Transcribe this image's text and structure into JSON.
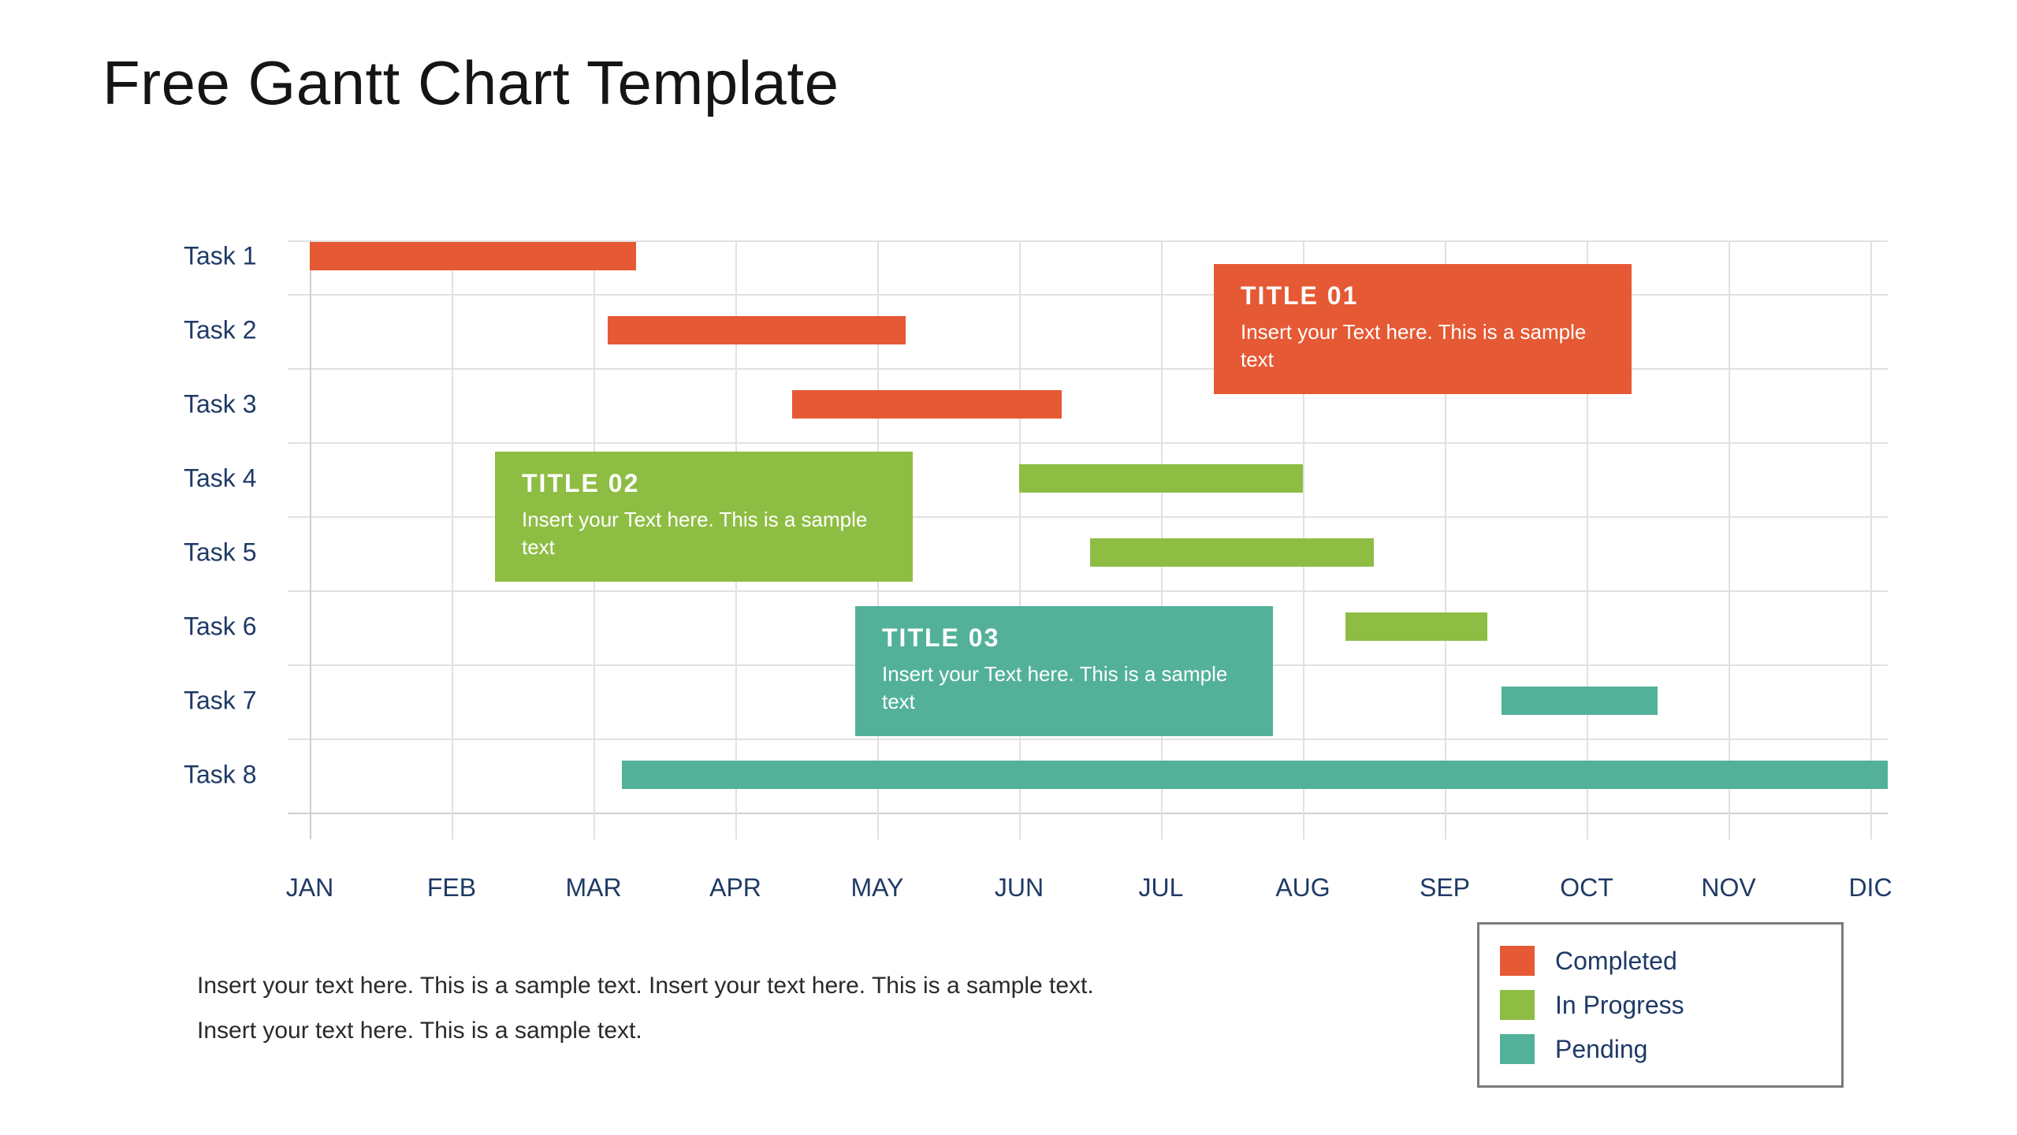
{
  "title": "Free Gantt Chart Template",
  "footer_text": "Insert your text here. This is a sample text. Insert your text here. This is a sample text.\nInsert your text here. This is a sample text.",
  "legend": {
    "completed": "Completed",
    "in_progress": "In Progress",
    "pending": "Pending"
  },
  "colors": {
    "completed": "#e55934",
    "in_progress": "#8ebd44",
    "pending": "#53b19a"
  },
  "callouts": [
    {
      "title": "TITLE 01",
      "body": "Insert your Text here. This is a sample text"
    },
    {
      "title": "TITLE 02",
      "body": "Insert your Text here. This is a sample text"
    },
    {
      "title": "TITLE 03",
      "body": "Insert your Text here. This is a sample text"
    }
  ],
  "chart_data": {
    "type": "bar",
    "orientation": "horizontal-gantt",
    "categories": [
      "JAN",
      "FEB",
      "MAR",
      "APR",
      "MAY",
      "JUN",
      "JUL",
      "AUG",
      "SEP",
      "OCT",
      "NOV",
      "DIC"
    ],
    "tasks": [
      "Task 1",
      "Task 2",
      "Task 3",
      "Task 4",
      "Task 5",
      "Task 6",
      "Task 7",
      "Task 8"
    ],
    "xlabel": "",
    "ylabel": "",
    "xlim": [
      1,
      12
    ],
    "series": [
      {
        "name": "Completed",
        "values": [
          {
            "task": "Task 1",
            "start": 1.0,
            "end": 3.3
          },
          {
            "task": "Task 2",
            "start": 3.1,
            "end": 5.2
          },
          {
            "task": "Task 3",
            "start": 4.4,
            "end": 6.3
          }
        ]
      },
      {
        "name": "In Progress",
        "values": [
          {
            "task": "Task 4",
            "start": 6.0,
            "end": 8.0
          },
          {
            "task": "Task 5",
            "start": 6.5,
            "end": 8.5
          },
          {
            "task": "Task 6",
            "start": 8.3,
            "end": 9.3
          }
        ]
      },
      {
        "name": "Pending",
        "values": [
          {
            "task": "Task 7",
            "start": 9.4,
            "end": 10.5
          },
          {
            "task": "Task 8",
            "start": 3.2,
            "end": 12.0
          }
        ]
      }
    ],
    "title": ""
  }
}
